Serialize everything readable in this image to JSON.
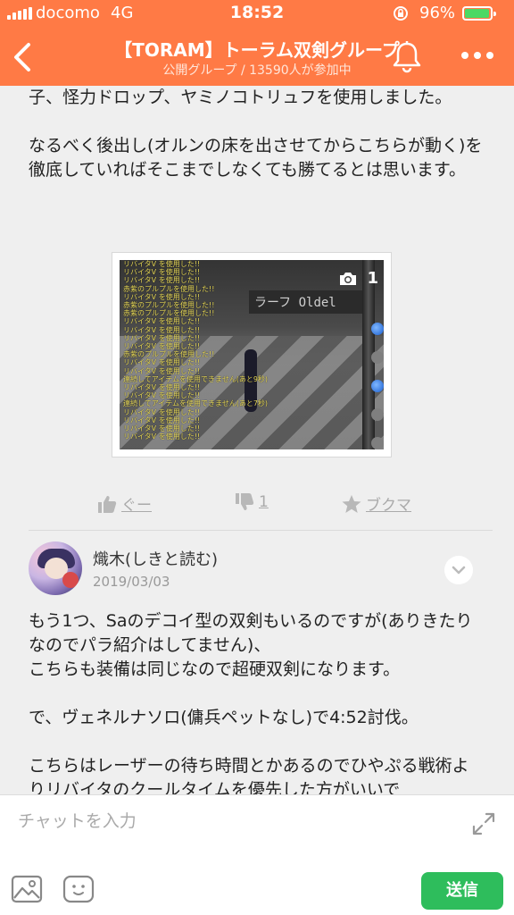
{
  "status_bar": {
    "carrier": "docomo",
    "network": "4G",
    "time": "18:52",
    "battery": "96%",
    "battery_level": 0.96
  },
  "header": {
    "title": "【TORAM】トーラム双剣グループ",
    "subtitle": "公開グループ / 13590人が参加中",
    "icons": [
      "back-icon",
      "bell-icon",
      "more-icon"
    ]
  },
  "message1": {
    "paragraphs": [
      "子、怪力ドロップ、ヤミノコトリュフを使用しました。",
      "なるべく後出し(オルンの床を出させてからこちらが動く)を徹底していればそこまでしなくても勝てるとは思います。"
    ],
    "photo": {
      "count": "1",
      "sign_text": "ラーフ  Oldel",
      "log_lines": [
        "リバイタV を使用した!!",
        "リバイタV を使用した!!",
        "リバイタV を使用した!!",
        "赤紫のプルプルを使用した!!",
        "リバイタV を使用した!!",
        "赤紫のプルプルを使用した!!",
        "赤紫のプルプルを使用した!!",
        "リバイタV を使用した!!",
        "リバイタV を使用した!!",
        "リバイタV を使用した!!",
        "リバイタV を使用した!!",
        "赤紫のプルプルを使用した!!",
        "リバイタV を使用した!!",
        "リバイタV を使用した!!",
        "連続してアイテムを使用できません(あと9秒)",
        "リバイタV を使用した!!",
        "リバイタV を使用した!!",
        "連続してアイテムを使用できません(あと7秒)",
        "リバイタV を使用した!!",
        "リバイタV を使用した!!",
        "リバイタV を使用した!!",
        "リバイタV を使用した!!"
      ]
    },
    "actions": {
      "like_label": "ぐー",
      "dislike_count": "1",
      "bookmark_label": "ブクマ"
    }
  },
  "message2": {
    "author": "熾木(しきと読む)",
    "date": "2019/03/03",
    "paragraphs": [
      "もう1つ、Saのデコイ型の双剣もいるのですが(ありきたりなのでパラ紹介はしてません)、\nこちらも装備は同じなので超硬双剣になります。",
      "で、ヴェネルナソロ(傭兵ペットなし)で4:52討伐。",
      "こちらはレーザーの待ち時間とかあるのでひやぷる戦術よりリバイタのクールタイムを優先した方がいいで"
    ]
  },
  "composer": {
    "placeholder": "チャットを入力",
    "send_label": "送信"
  },
  "colors": {
    "header": "#ff7a45",
    "send": "#2ebd5c",
    "background": "#efefef"
  }
}
